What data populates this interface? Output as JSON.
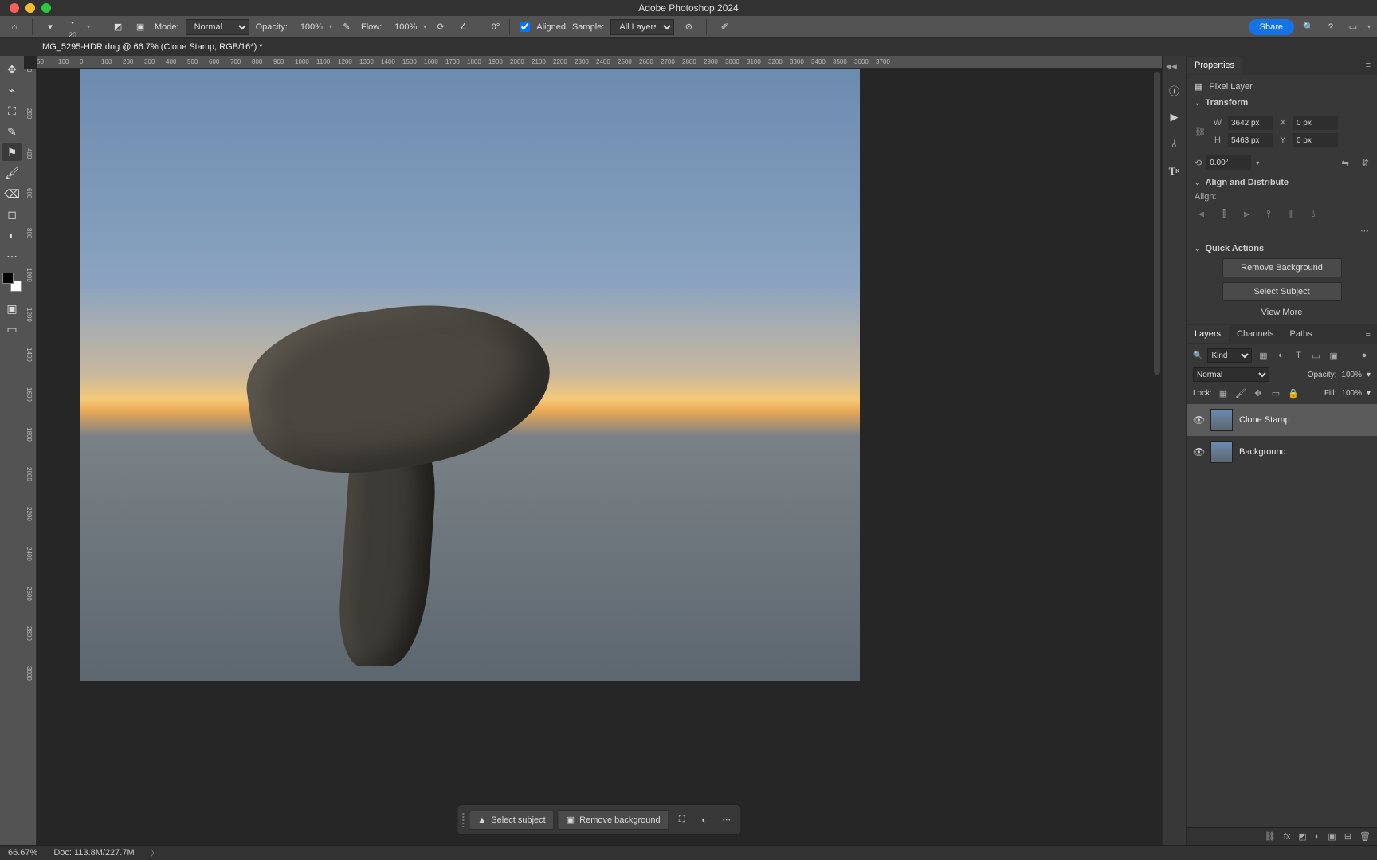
{
  "app": {
    "title": "Adobe Photoshop 2024"
  },
  "optbar": {
    "brush_size": "20",
    "mode_label": "Mode:",
    "mode_value": "Normal",
    "opacity_label": "Opacity:",
    "opacity_value": "100%",
    "flow_label": "Flow:",
    "flow_value": "100%",
    "angle_value": "0°",
    "aligned_label": "Aligned",
    "sample_label": "Sample:",
    "sample_value": "All Layers",
    "share": "Share"
  },
  "tab": {
    "label": "IMG_5295-HDR.dng @ 66.7% (Clone Stamp, RGB/16*) *"
  },
  "ruler": {
    "h": [
      "50",
      "100",
      "0",
      "100",
      "200",
      "300",
      "400",
      "500",
      "600",
      "700",
      "800",
      "900",
      "1000",
      "1100",
      "1200",
      "1300",
      "1400",
      "1500",
      "1600",
      "1700",
      "1800",
      "1900",
      "2000",
      "2100",
      "2200",
      "2300",
      "2400",
      "2500",
      "2600",
      "2700",
      "2800",
      "2900",
      "3000",
      "3100",
      "3200",
      "3300",
      "3400",
      "3500",
      "3600",
      "3700"
    ],
    "v": [
      "0",
      "200",
      "400",
      "600",
      "800",
      "1000",
      "1200",
      "1400",
      "1600",
      "1800",
      "2000",
      "2200",
      "2400",
      "2600",
      "2800",
      "3000"
    ]
  },
  "ctxbar": {
    "select_subject": "Select subject",
    "remove_background": "Remove background"
  },
  "properties": {
    "title": "Properties",
    "layer_type": "Pixel Layer",
    "transform": {
      "title": "Transform",
      "w": "3642 px",
      "x": "0 px",
      "h": "5463 px",
      "y": "0 px",
      "angle": "0.00°"
    },
    "align": {
      "title": "Align and Distribute",
      "label": "Align:"
    },
    "quick_actions": {
      "title": "Quick Actions",
      "remove_bg": "Remove Background",
      "select_subject": "Select Subject",
      "view_more": "View More"
    }
  },
  "layers_panel": {
    "tabs": [
      "Layers",
      "Channels",
      "Paths"
    ],
    "kind": "Kind",
    "blend": "Normal",
    "opacity_label": "Opacity:",
    "opacity": "100%",
    "lock_label": "Lock:",
    "fill_label": "Fill:",
    "fill": "100%",
    "layers": [
      {
        "name": "Clone Stamp",
        "selected": true
      },
      {
        "name": "Background",
        "selected": false
      }
    ]
  },
  "status": {
    "zoom": "66.67%",
    "doc": "Doc: 113.8M/227.7M"
  }
}
